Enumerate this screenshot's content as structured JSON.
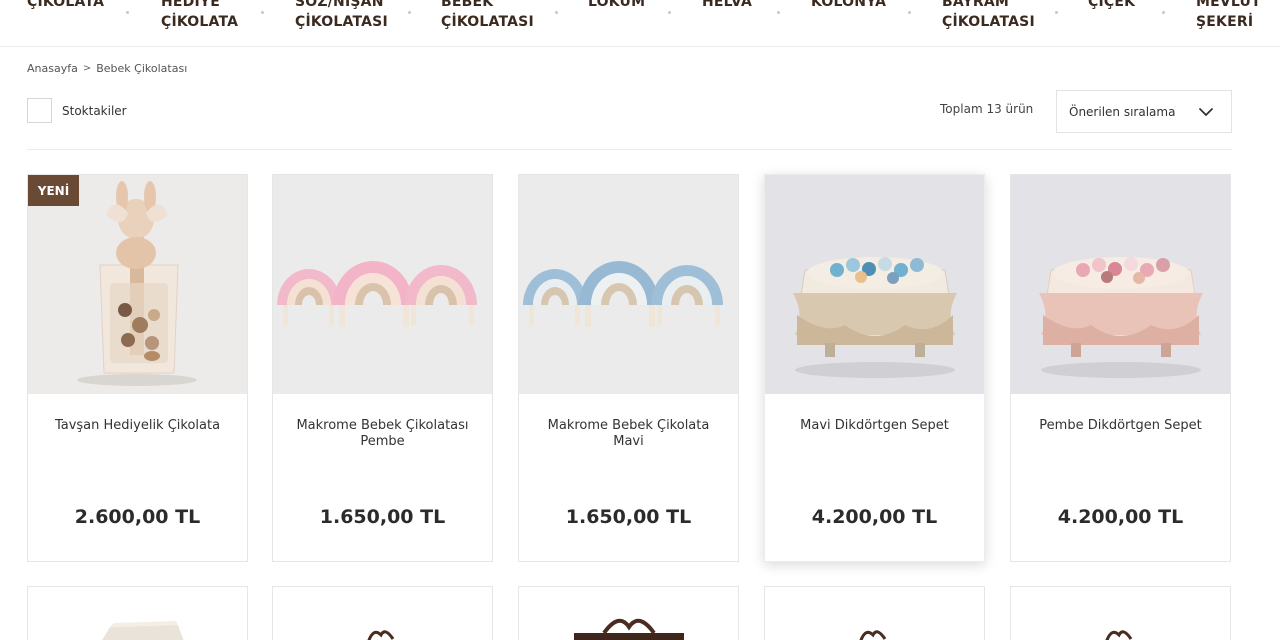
{
  "nav": {
    "items": [
      {
        "id": "cikolata",
        "lines": [
          "ÇİKOLATA"
        ]
      },
      {
        "id": "hediye",
        "lines": [
          "HEDİYE",
          "ÇİKOLATA"
        ]
      },
      {
        "id": "soz",
        "lines": [
          "SÖZ/NİŞAN",
          "ÇİKOLATASI"
        ]
      },
      {
        "id": "bebek",
        "lines": [
          "BEBEK",
          "ÇİKOLATASI"
        ]
      },
      {
        "id": "lokum",
        "lines": [
          "LOKUM"
        ]
      },
      {
        "id": "helva",
        "lines": [
          "HELVA"
        ]
      },
      {
        "id": "kolonya",
        "lines": [
          "KOLONYA"
        ]
      },
      {
        "id": "bayram",
        "lines": [
          "BAYRAM",
          "ÇİKOLATASI"
        ]
      },
      {
        "id": "cicek",
        "lines": [
          "ÇİÇEK"
        ]
      },
      {
        "id": "mevlut",
        "lines": [
          "MEVLÜT",
          "ŞEKERİ"
        ]
      }
    ]
  },
  "breadcrumb": {
    "home": "Anasayfa",
    "separator": ">",
    "current": "Bebek Çikolatası"
  },
  "filters": {
    "stock_label": "Stoktakiler",
    "stock_checked": false
  },
  "listing": {
    "total": "Toplam 13 ürün",
    "sort_label": "Önerilen sıralama"
  },
  "colors": {
    "badge": "#6b4a35",
    "text": "#333333",
    "price": "#2b2b2b"
  },
  "products": [
    {
      "name": "Tavşan Hediyelik Çikolata",
      "price": "2.600,00 TL",
      "badge": "YENİ",
      "image": "rabbit-gift-box"
    },
    {
      "name": "Makrome Bebek Çikolatası Pembe",
      "price": "1.650,00 TL",
      "badge": "",
      "image": "pink-macrame-rainbows"
    },
    {
      "name": "Makrome Bebek Çikolata Mavi",
      "price": "1.650,00 TL",
      "badge": "",
      "image": "blue-macrame-rainbows"
    },
    {
      "name": "Mavi Dikdörtgen Sepet",
      "price": "4.200,00 TL",
      "badge": "",
      "image": "blue-lace-basket"
    },
    {
      "name": "Pembe Dikdörtgen Sepet",
      "price": "4.200,00 TL",
      "badge": "",
      "image": "pink-lace-basket"
    }
  ],
  "second_row": [
    {
      "image": "cream-box-partial"
    },
    {
      "image": "ribbon-partial"
    },
    {
      "image": "brown-box-ribbon-partial"
    },
    {
      "image": "ribbon-partial"
    },
    {
      "image": "ribbon-partial"
    }
  ]
}
